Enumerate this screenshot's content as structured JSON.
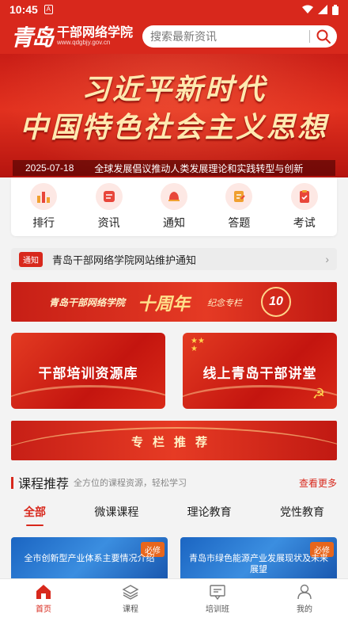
{
  "status_bar": {
    "time": "10:45",
    "sim_label": "A"
  },
  "header": {
    "logo_mark": "青岛",
    "title": "干部网络学院",
    "url": "www.qdgbjy.gov.cn",
    "search_placeholder": "搜索最新资讯"
  },
  "hero": {
    "line1": "习近平新时代",
    "line2": "中国特色社会主义思想",
    "date": "2025-07-18",
    "caption": "全球发展倡议推动人类发展理论和实践转型与创新"
  },
  "quick_nav": [
    {
      "label": "排行",
      "icon": "ranking-icon"
    },
    {
      "label": "资讯",
      "icon": "news-icon"
    },
    {
      "label": "通知",
      "icon": "bell-icon"
    },
    {
      "label": "答题",
      "icon": "quiz-icon"
    },
    {
      "label": "考试",
      "icon": "exam-icon"
    }
  ],
  "notice": {
    "tag": "通知",
    "text": "青岛干部网络学院网站维护通知"
  },
  "banner_anniversary": {
    "left": "青岛干部网络学院",
    "big": "十周年",
    "sub": "纪念专栏",
    "badge": "10"
  },
  "promo_cards": [
    {
      "label": "干部培训资源库"
    },
    {
      "label": "线上青岛干部讲堂"
    }
  ],
  "banner_column": {
    "label": "专栏推荐"
  },
  "course_section": {
    "title": "课程推荐",
    "subtitle": "全方位的课程资源，轻松学习",
    "more": "查看更多",
    "tabs": [
      "全部",
      "微课课程",
      "理论教育",
      "党性教育"
    ],
    "active_tab": 0,
    "courses": [
      {
        "title": "全市创新型产业体系主要情况介绍",
        "badge": "必修"
      },
      {
        "title": "青岛市绿色能源产业发展现状及未来展望",
        "badge": "必修"
      }
    ]
  },
  "bottom_nav": [
    {
      "label": "首页",
      "icon": "home-icon",
      "active": true
    },
    {
      "label": "课程",
      "icon": "layers-icon",
      "active": false
    },
    {
      "label": "培训班",
      "icon": "chat-board-icon",
      "active": false
    },
    {
      "label": "我的",
      "icon": "user-icon",
      "active": false
    }
  ],
  "colors": {
    "primary": "#d8281c",
    "accent_gold": "#ffe9b0",
    "course_blue": "#1b65c2"
  }
}
